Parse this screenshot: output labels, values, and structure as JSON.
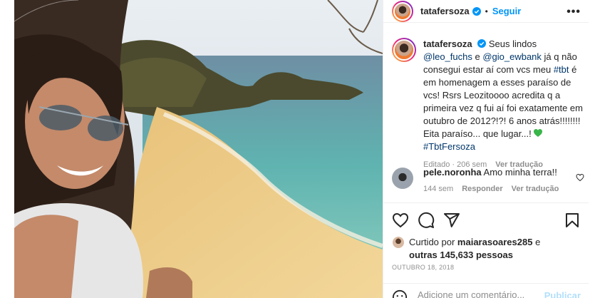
{
  "post": {
    "username": "tatafersoza",
    "follow_label": "Seguir",
    "separator": "•",
    "more_label": "•••"
  },
  "caption": {
    "username": "tatafersoza",
    "part1": "Seus lindos ",
    "mention1": "@leo_fuchs",
    "part2": " e ",
    "mention2": "@gio_ewbank",
    "part3": " já q não consegui estar aí com vcs meu ",
    "hashtag1": "#tbt",
    "part4": " é em homenagem a esses paraíso de vcs! Rsrs Leozitoooo acredita q a primeira vez q fui aí foi exatamente em outubro de 2012?!?! 6 anos atrás!!!!!!!! Eita paraíso... que lugar...! ",
    "hashtag2": "#TbtFersoza",
    "edited": "Editado",
    "dot": " · ",
    "time": "206 sem",
    "translate": "Ver tradução"
  },
  "comment": {
    "username": "pele.noronha",
    "text": "Amo minha terra!!",
    "time": "144 sem",
    "reply": "Responder",
    "translate": "Ver tradução"
  },
  "likes": {
    "prefix": "Curtido por ",
    "user": "maiarasoares285",
    "middle": " e ",
    "others": "outras 145,633 pessoas"
  },
  "date": "OUTUBRO 18, 2018",
  "add_comment": {
    "placeholder": "Adicione um comentário...",
    "publish": "Publicar"
  },
  "colors": {
    "accent": "#0095f6",
    "link": "#00376b",
    "muted": "#8e8e8e",
    "heart_emoji": "#39b54a"
  }
}
